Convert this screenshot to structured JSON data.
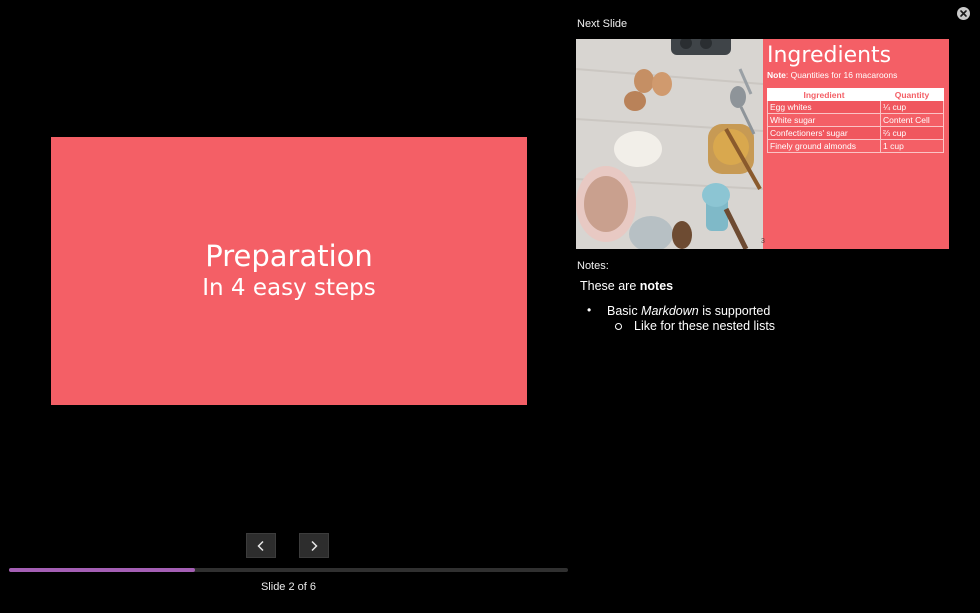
{
  "current_slide": {
    "title": "Preparation",
    "subtitle": "In 4 easy steps",
    "background": "#f45f66"
  },
  "navigation": {
    "prev_icon": "chevron-left-icon",
    "next_icon": "chevron-right-icon",
    "progress_fraction": 0.333,
    "counter": "Slide 2 of 6"
  },
  "next_slide": {
    "label": "Next Slide",
    "title": "Ingredients",
    "note_bold": "Note",
    "note_text": ": Quantities for 16 macaroons",
    "page_number": "3",
    "table": {
      "headers": [
        "Ingredient",
        "Quantity"
      ],
      "rows": [
        [
          "Egg whites",
          "¼ cup"
        ],
        [
          "White sugar",
          "Content Cell"
        ],
        [
          "Confectioners' sugar",
          "⅔ cup"
        ],
        [
          "Finely ground almonds",
          "1 cup"
        ]
      ]
    }
  },
  "notes": {
    "label": "Notes:",
    "line_prefix": "These are ",
    "line_bold": "notes",
    "bullet_prefix": "Basic ",
    "bullet_italic": "Markdown",
    "bullet_suffix": " is supported",
    "nested_item": "Like for these nested lists"
  },
  "close_icon": "close-icon"
}
